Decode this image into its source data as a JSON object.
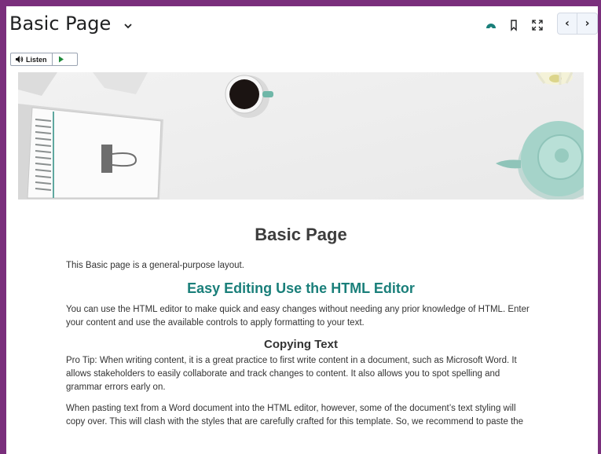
{
  "header": {
    "title": "Basic Page",
    "title_menu_icon": "chevron-down-icon",
    "tools": [
      "progress-gauge-icon",
      "bookmark-icon",
      "fullscreen-icon"
    ],
    "nav_prev_label": "‹",
    "nav_next_label": "›"
  },
  "readspeaker": {
    "listen_label": "Listen",
    "listen_icon": "speaker-icon",
    "play_icon": "play-icon"
  },
  "banner": {
    "image_name": "desk-flatlay-banner"
  },
  "content": {
    "heading": "Basic Page",
    "intro": "This Basic page is a general-purpose layout.",
    "section1_heading": "Easy Editing Use the HTML Editor",
    "section1_text": "You can use the HTML editor to make quick and easy changes without needing any prior knowledge of HTML. Enter your content and use the available controls to apply formatting to your text.",
    "section2_heading": "Copying Text",
    "section2_text1": "Pro Tip: When writing content, it is a great practice to first write content in a document, such as Microsoft Word. It allows stakeholders to easily collaborate and track changes to content. It also allows you to spot spelling and grammar errors early on.",
    "section2_text2": "When pasting text from a Word document into the HTML editor, however, some of the document’s text styling will copy over. This will clash with the styles that are carefully crafted for this template. So, we recommend to paste the"
  },
  "colors": {
    "frame": "#7a2f7c",
    "accent_heading": "#1a7f7a",
    "gauge_icon": "#1a7f7a"
  }
}
